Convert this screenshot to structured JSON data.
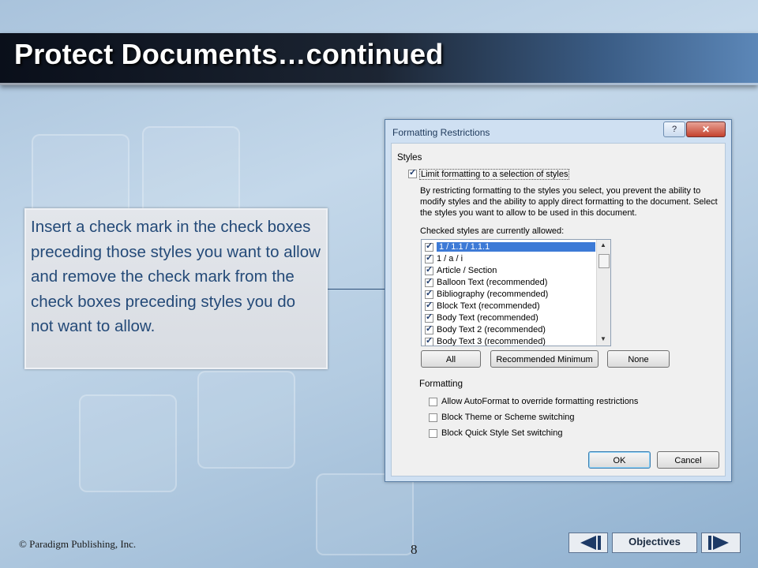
{
  "slide": {
    "title": "Protect Documents…continued",
    "callout_text": "Insert a check mark in the check boxes preceding those styles you want to allow and remove the check mark from the check boxes preceding styles you do not want to allow.",
    "copyright": "© Paradigm Publishing, Inc.",
    "page_number": "8",
    "nav": {
      "objectives_label": "Objectives"
    }
  },
  "dialog": {
    "title": "Formatting Restrictions",
    "help_label": "?",
    "close_label": "✕",
    "styles_group": "Styles",
    "limit_checkbox": {
      "label": "Limit formatting to a selection of styles",
      "checked": true
    },
    "description": "By restricting formatting to the styles you select, you prevent the ability to modify styles and the ability to apply direct formatting to the document. Select the styles you want to allow to be used in this document.",
    "list_label": "Checked styles are currently allowed:",
    "styles_list": [
      {
        "label": "1 / 1.1 / 1.1.1",
        "checked": true,
        "selected": true
      },
      {
        "label": "1 / a / i",
        "checked": true
      },
      {
        "label": "Article / Section",
        "checked": true
      },
      {
        "label": "Balloon Text (recommended)",
        "checked": true
      },
      {
        "label": "Bibliography (recommended)",
        "checked": true
      },
      {
        "label": "Block Text (recommended)",
        "checked": true
      },
      {
        "label": "Body Text (recommended)",
        "checked": true
      },
      {
        "label": "Body Text 2 (recommended)",
        "checked": true
      },
      {
        "label": "Body Text 3 (recommended)",
        "checked": true
      }
    ],
    "buttons": {
      "all": "All",
      "recommended_minimum": "Recommended Minimum",
      "none": "None",
      "ok": "OK",
      "cancel": "Cancel"
    },
    "formatting_group": "Formatting",
    "formatting_options": [
      {
        "label": "Allow AutoFormat to override formatting restrictions",
        "checked": false
      },
      {
        "label": "Block Theme or Scheme switching",
        "checked": false
      },
      {
        "label": "Block Quick Style Set switching",
        "checked": false
      }
    ]
  }
}
